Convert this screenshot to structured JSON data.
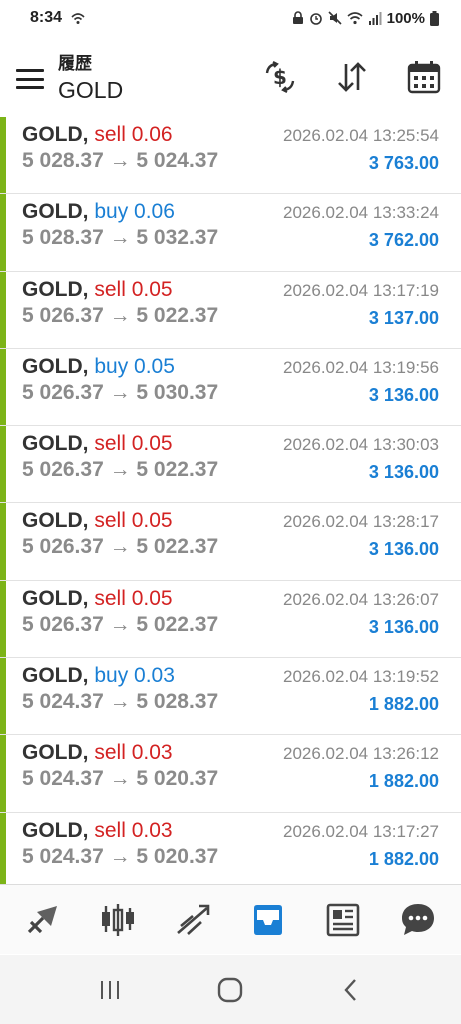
{
  "status_bar": {
    "time": "8:34",
    "battery": "100%"
  },
  "header": {
    "subtitle": "履歴",
    "title": "GOLD"
  },
  "colors": {
    "sell": "#d32222",
    "buy": "#1a7fd4",
    "profit": "#1a7fd4",
    "accent_bar": "#7cb418",
    "active_tab": "#1a7fd4"
  },
  "trades": [
    {
      "symbol": "GOLD,",
      "action": "sell 0.06",
      "side": "sell",
      "time": "2026.02.04 13:25:54",
      "prices": "5 028.37 → 5 024.37",
      "profit": "3 763.00"
    },
    {
      "symbol": "GOLD,",
      "action": "buy 0.06",
      "side": "buy",
      "time": "2026.02.04 13:33:24",
      "prices": "5 028.37 → 5 032.37",
      "profit": "3 762.00"
    },
    {
      "symbol": "GOLD,",
      "action": "sell 0.05",
      "side": "sell",
      "time": "2026.02.04 13:17:19",
      "prices": "5 026.37 → 5 022.37",
      "profit": "3 137.00"
    },
    {
      "symbol": "GOLD,",
      "action": "buy 0.05",
      "side": "buy",
      "time": "2026.02.04 13:19:56",
      "prices": "5 026.37 → 5 030.37",
      "profit": "3 136.00"
    },
    {
      "symbol": "GOLD,",
      "action": "sell 0.05",
      "side": "sell",
      "time": "2026.02.04 13:30:03",
      "prices": "5 026.37 → 5 022.37",
      "profit": "3 136.00"
    },
    {
      "symbol": "GOLD,",
      "action": "sell 0.05",
      "side": "sell",
      "time": "2026.02.04 13:28:17",
      "prices": "5 026.37 → 5 022.37",
      "profit": "3 136.00"
    },
    {
      "symbol": "GOLD,",
      "action": "sell 0.05",
      "side": "sell",
      "time": "2026.02.04 13:26:07",
      "prices": "5 026.37 → 5 022.37",
      "profit": "3 136.00"
    },
    {
      "symbol": "GOLD,",
      "action": "buy 0.03",
      "side": "buy",
      "time": "2026.02.04 13:19:52",
      "prices": "5 024.37 → 5 028.37",
      "profit": "1 882.00"
    },
    {
      "symbol": "GOLD,",
      "action": "sell 0.03",
      "side": "sell",
      "time": "2026.02.04 13:26:12",
      "prices": "5 024.37 → 5 020.37",
      "profit": "1 882.00"
    },
    {
      "symbol": "GOLD,",
      "action": "sell 0.03",
      "side": "sell",
      "time": "2026.02.04 13:17:27",
      "prices": "5 024.37 → 5 020.37",
      "profit": "1 882.00"
    }
  ],
  "bottom_nav": [
    {
      "icon": "quotes-icon",
      "active": false
    },
    {
      "icon": "chart-icon",
      "active": false
    },
    {
      "icon": "trade-icon",
      "active": false
    },
    {
      "icon": "history-icon",
      "active": true
    },
    {
      "icon": "news-icon",
      "active": false
    },
    {
      "icon": "chat-icon",
      "active": false
    }
  ]
}
